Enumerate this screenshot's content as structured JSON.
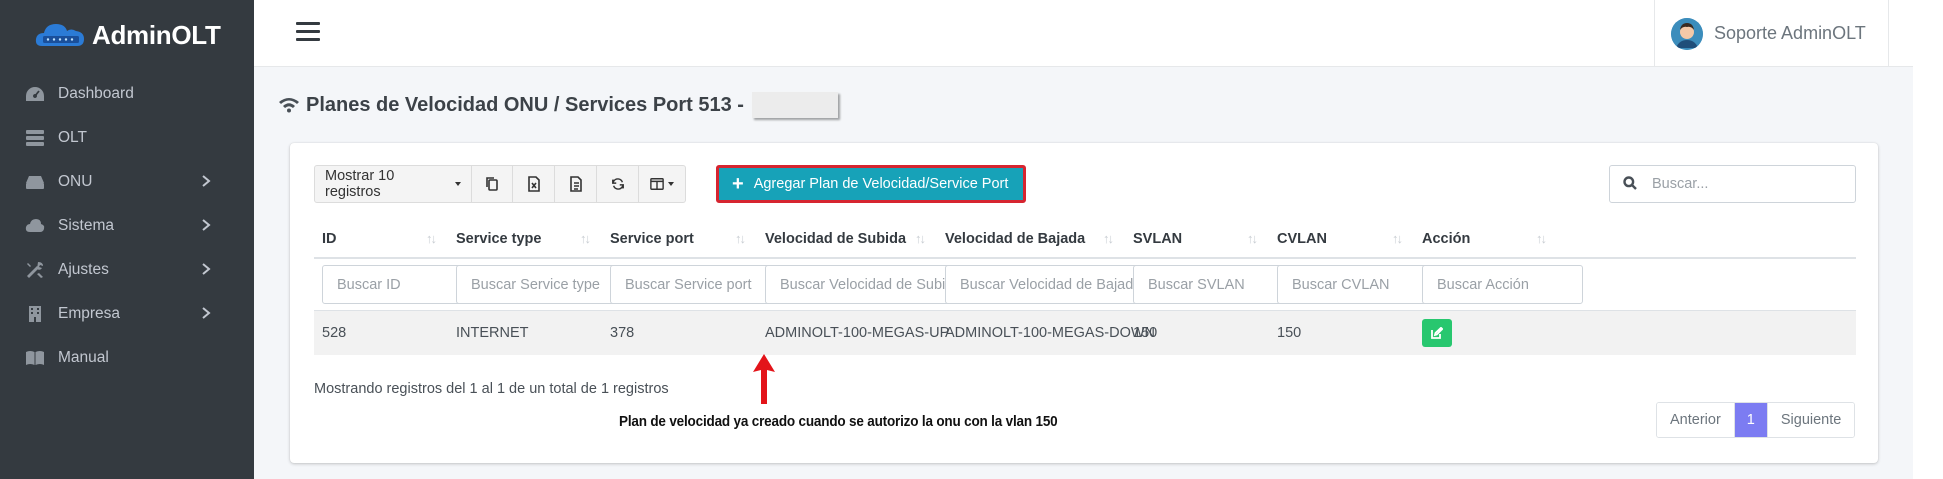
{
  "brand": {
    "name": "AdminOLT"
  },
  "sidebar": {
    "items": [
      {
        "label": "Dashboard",
        "icon": "tachometer-icon",
        "has_submenu": false
      },
      {
        "label": "OLT",
        "icon": "server-icon",
        "has_submenu": false
      },
      {
        "label": "ONU",
        "icon": "hdd-icon",
        "has_submenu": true
      },
      {
        "label": "Sistema",
        "icon": "cloud-icon",
        "has_submenu": true
      },
      {
        "label": "Ajustes",
        "icon": "tools-icon",
        "has_submenu": true
      },
      {
        "label": "Empresa",
        "icon": "building-icon",
        "has_submenu": true
      },
      {
        "label": "Manual",
        "icon": "book-icon",
        "has_submenu": false
      }
    ]
  },
  "header": {
    "user_name": "Soporte AdminOLT"
  },
  "page": {
    "title": "Planes de Velocidad ONU / Services Port 513 -"
  },
  "toolbar": {
    "show_records_label": "Mostrar 10 registros",
    "add_button_label": "Agregar Plan de Velocidad/Service Port",
    "search_placeholder": "Buscar..."
  },
  "table": {
    "columns": [
      {
        "label": "ID",
        "filter_placeholder": "Buscar ID"
      },
      {
        "label": "Service type",
        "filter_placeholder": "Buscar Service type"
      },
      {
        "label": "Service port",
        "filter_placeholder": "Buscar Service port"
      },
      {
        "label": "Velocidad de Subida",
        "filter_placeholder": "Buscar Velocidad de Subida"
      },
      {
        "label": "Velocidad de Bajada",
        "filter_placeholder": "Buscar Velocidad de Bajada"
      },
      {
        "label": "SVLAN",
        "filter_placeholder": "Buscar SVLAN"
      },
      {
        "label": "CVLAN",
        "filter_placeholder": "Buscar CVLAN"
      },
      {
        "label": "Acción",
        "filter_placeholder": "Buscar Acción"
      }
    ],
    "rows": [
      [
        "528",
        "INTERNET",
        "378",
        "ADMINOLT-100-MEGAS-UP",
        "ADMINOLT-100-MEGAS-DOWN",
        "150",
        "150"
      ]
    ]
  },
  "footer": {
    "info": "Mostrando registros del 1 al 1 de un total de 1 registros",
    "prev_label": "Anterior",
    "current_page": "1",
    "next_label": "Siguiente"
  },
  "annotation": {
    "text": "Plan de velocidad ya creado cuando se autorizo la onu con la vlan 150"
  },
  "colors": {
    "sidebar_bg": "#343a40",
    "accent_info": "#17a2b8",
    "highlight_border": "#d62530",
    "edit_button": "#28c76f",
    "active_page": "#7c7cf2",
    "arrow": "#e3141a"
  }
}
